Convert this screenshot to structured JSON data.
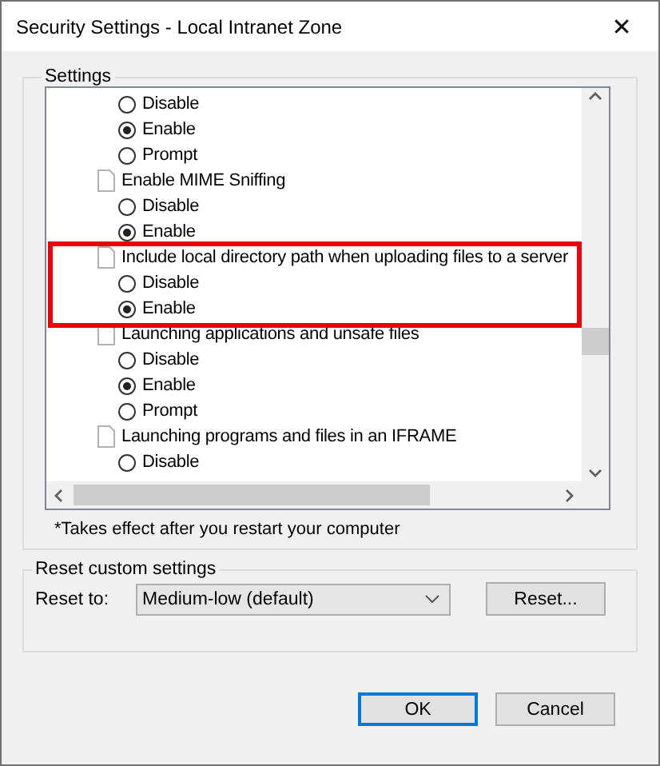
{
  "window": {
    "title": "Security Settings - Local Intranet Zone",
    "close": "✕"
  },
  "settings": {
    "label": "Settings",
    "groups": [
      {
        "options": [
          {
            "label": "Disable",
            "selected": false
          },
          {
            "label": "Enable",
            "selected": true
          },
          {
            "label": "Prompt",
            "selected": false
          }
        ]
      },
      {
        "title": "Enable MIME Sniffing",
        "options": [
          {
            "label": "Disable",
            "selected": false
          },
          {
            "label": "Enable",
            "selected": true
          }
        ]
      },
      {
        "title": "Include local directory path when uploading files to a server",
        "highlighted": true,
        "options": [
          {
            "label": "Disable",
            "selected": false
          },
          {
            "label": "Enable",
            "selected": true
          }
        ]
      },
      {
        "title": "Launching applications and unsafe files",
        "options": [
          {
            "label": "Disable",
            "selected": false
          },
          {
            "label": "Enable",
            "selected": true
          },
          {
            "label": "Prompt",
            "selected": false
          }
        ]
      },
      {
        "title": "Launching programs and files in an IFRAME",
        "options": [
          {
            "label": "Disable",
            "selected": false
          }
        ]
      }
    ],
    "note": "*Takes effect after you restart your computer"
  },
  "reset": {
    "label": "Reset custom settings",
    "field_label": "Reset to:",
    "value": "Medium-low (default)",
    "button": "Reset..."
  },
  "buttons": [
    {
      "label": "OK",
      "default": true
    },
    {
      "label": "Cancel",
      "default": false
    }
  ]
}
